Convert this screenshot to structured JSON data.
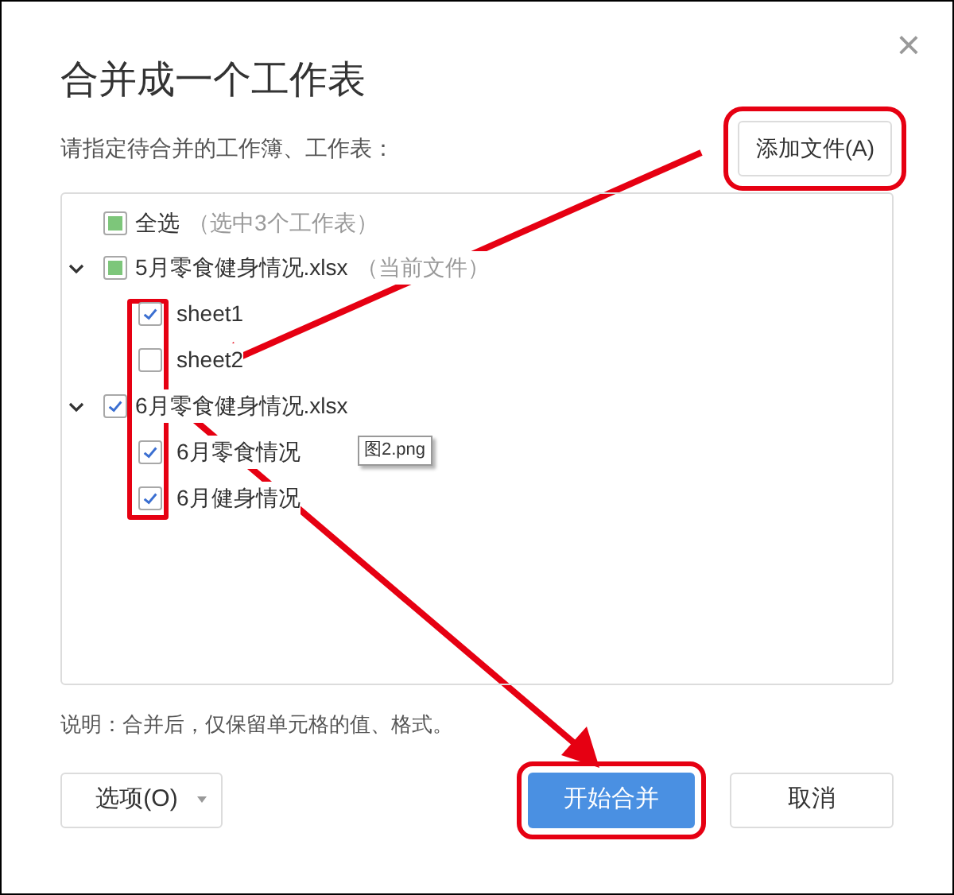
{
  "dialog": {
    "title": "合并成一个工作表",
    "close_icon": "×"
  },
  "prompt": "请指定待合并的工作簿、工作表：",
  "add_file_button": "添加文件(A)",
  "select_all": {
    "label": "全选",
    "note": "（选中3个工作表）",
    "checked": false,
    "partial": true
  },
  "files": [
    {
      "name": "5月零食健身情况.xlsx",
      "note": "（当前文件）",
      "checked": false,
      "partial": true,
      "expanded": true,
      "children": [
        {
          "name": "sheet1",
          "checked": true
        },
        {
          "name": "sheet2",
          "checked": false
        }
      ]
    },
    {
      "name": "6月零食健身情况.xlsx",
      "checked": true,
      "partial": false,
      "expanded": true,
      "children": [
        {
          "name": "6月零食情况",
          "checked": true
        },
        {
          "name": "6月健身情况",
          "checked": true
        }
      ]
    }
  ],
  "tooltip": "图2.png",
  "note": "说明：合并后，仅保留单元格的值、格式。",
  "buttons": [
    {
      "label": "选项(O)",
      "kind": "dropdown"
    },
    {
      "label": "开始合并",
      "kind": "primary"
    },
    {
      "label": "取消",
      "kind": "secondary"
    }
  ]
}
